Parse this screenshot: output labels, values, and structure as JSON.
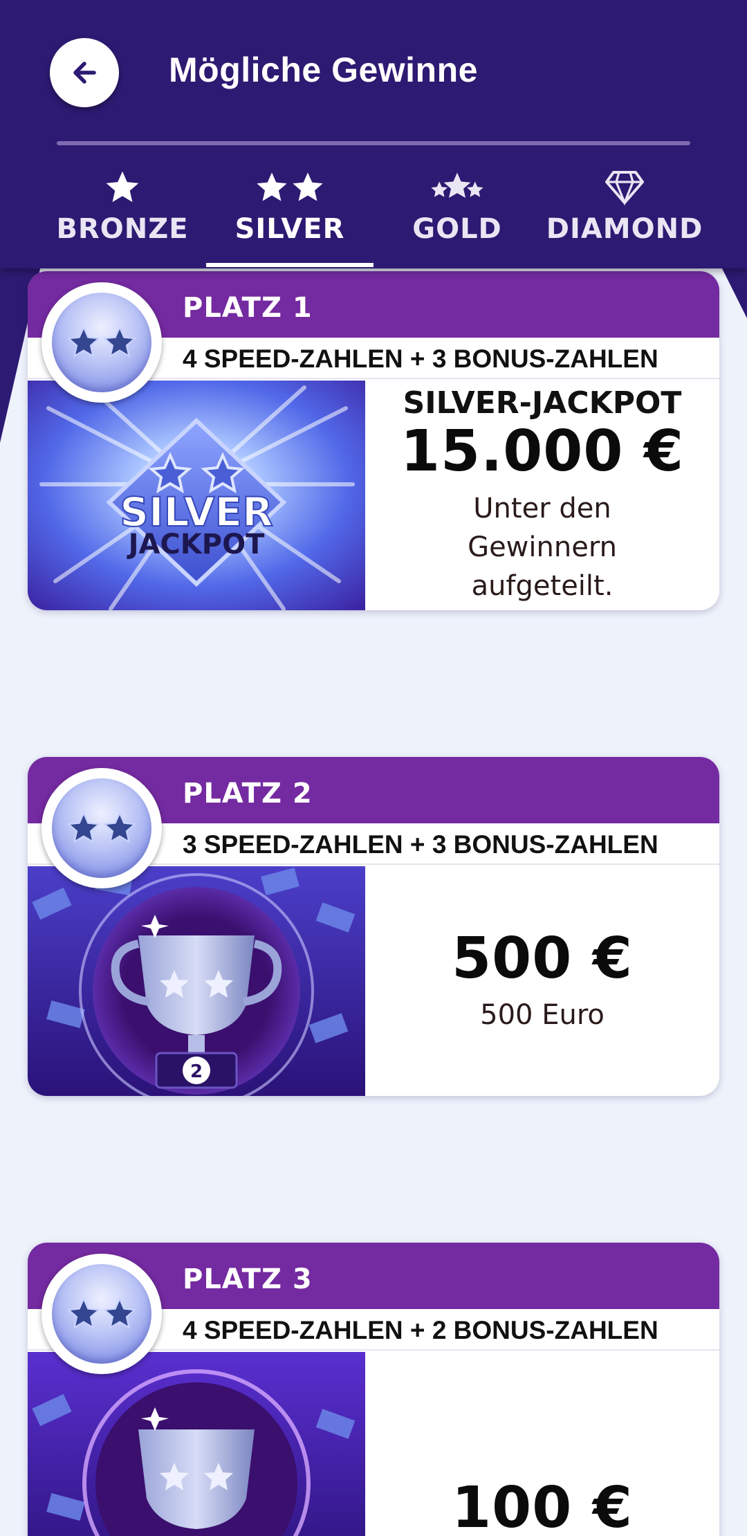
{
  "header": {
    "title": "Mögliche Gewinne",
    "back_icon": "arrow-left-icon"
  },
  "tabs": [
    {
      "label": "BRONZE",
      "icon": "star-icon",
      "selected": false
    },
    {
      "label": "SILVER",
      "icon": "two-stars-icon",
      "selected": true
    },
    {
      "label": "GOLD",
      "icon": "three-stars-icon",
      "selected": false
    },
    {
      "label": "DIAMOND",
      "icon": "diamond-icon",
      "selected": false
    }
  ],
  "prizes": [
    {
      "place": "PLATZ 1",
      "condition": "4 SPEED-ZAHLEN + 3 BONUS-ZAHLEN",
      "image_title": "SILVER",
      "image_subtitle": "JACKPOT",
      "title": "SILVER-JACKPOT",
      "amount": "15.000 €",
      "description_lines": [
        "Unter den",
        "Gewinnern",
        "aufgeteilt."
      ]
    },
    {
      "place": "PLATZ 2",
      "condition": "3 SPEED-ZAHLEN + 3 BONUS-ZAHLEN",
      "trophy_number": "2",
      "amount": "500 €",
      "description": "500 Euro"
    },
    {
      "place": "PLATZ 3",
      "condition": "4 SPEED-ZAHLEN + 2 BONUS-ZAHLEN",
      "amount": "100 €"
    }
  ],
  "colors": {
    "header": "#2d1a72",
    "band": "#742aa0",
    "background": "#eef2fb"
  }
}
